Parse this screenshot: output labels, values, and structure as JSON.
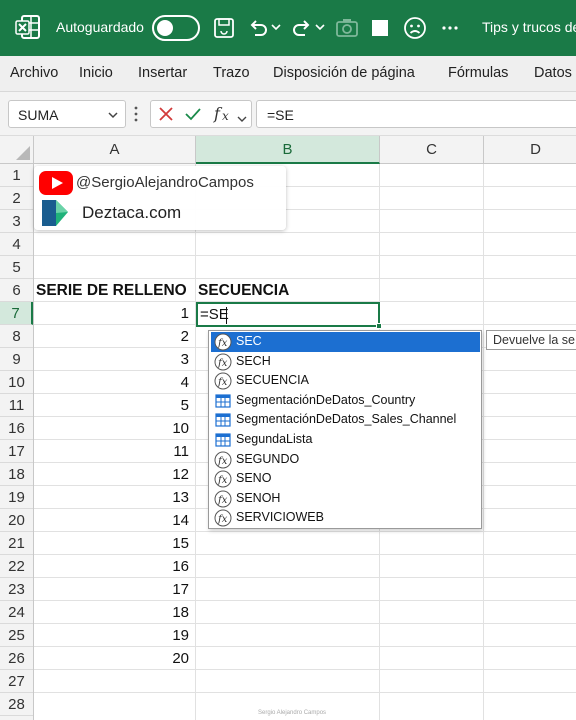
{
  "titlebar": {
    "autosave_label": "Autoguardado",
    "doc_title": "Tips y trucos de"
  },
  "menu": {
    "items": [
      "Archivo",
      "Inicio",
      "Insertar",
      "Trazo",
      "Disposición de página",
      "Fórmulas",
      "Datos"
    ]
  },
  "formula_bar": {
    "name_box": "SUMA",
    "formula": "=SE"
  },
  "columns": [
    "A",
    "B",
    "C",
    "D"
  ],
  "rows": [
    "1",
    "2",
    "3",
    "4",
    "5",
    "6",
    "7",
    "8",
    "9",
    "10",
    "11",
    "16",
    "17",
    "18",
    "19",
    "20",
    "21",
    "22",
    "23",
    "24",
    "25",
    "26",
    "27",
    "28"
  ],
  "sheet": {
    "header_a": "SERIE DE RELLENO",
    "header_b": "SECUENCIA",
    "values_a": [
      "1",
      "2",
      "3",
      "4",
      "5",
      "10",
      "11",
      "12",
      "13",
      "14",
      "15",
      "16",
      "17",
      "18",
      "19",
      "20"
    ],
    "active_input": "=SE"
  },
  "brand": {
    "youtube_handle": "@SergioAlejandroCampos",
    "site": "Deztaca.com"
  },
  "autocomplete": {
    "items": [
      {
        "label": "SEC",
        "icon": "function-icon"
      },
      {
        "label": "SECH",
        "icon": "function-icon"
      },
      {
        "label": "SECUENCIA",
        "icon": "function-icon"
      },
      {
        "label": "SegmentaciónDeDatos_Country",
        "icon": "table-icon"
      },
      {
        "label": "SegmentaciónDeDatos_Sales_Channel",
        "icon": "table-icon"
      },
      {
        "label": "SegundaLista",
        "icon": "table-icon"
      },
      {
        "label": "SEGUNDO",
        "icon": "function-icon"
      },
      {
        "label": "SENO",
        "icon": "function-icon"
      },
      {
        "label": "SENOH",
        "icon": "function-icon"
      },
      {
        "label": "SERVICIOWEB",
        "icon": "function-icon"
      }
    ],
    "tooltip": "Devuelve la se"
  },
  "watermark": "Sergio Alejandro Campos"
}
